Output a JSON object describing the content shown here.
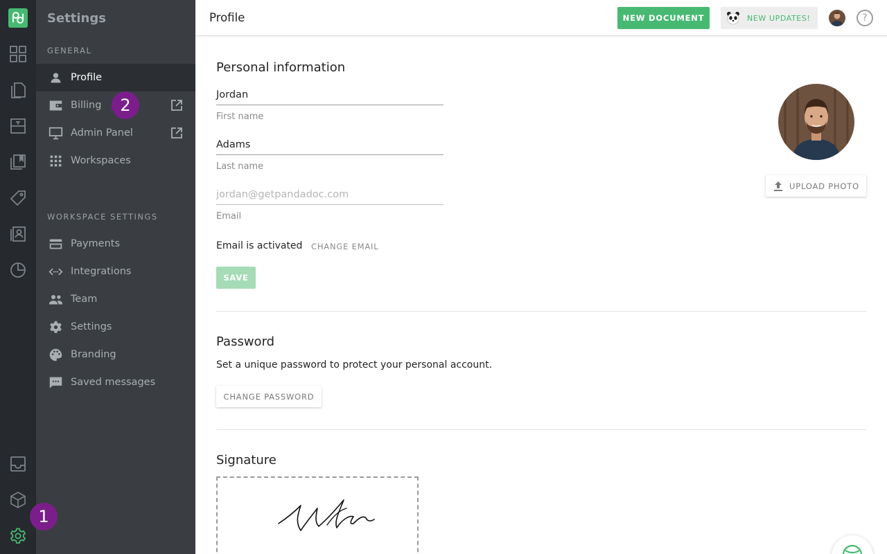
{
  "header": {
    "title": "Profile",
    "new_document_label": "NEW DOCUMENT",
    "new_updates_label": "NEW UPDATES!",
    "help_label": "?"
  },
  "sidebar": {
    "title": "Settings",
    "general_heading": "GENERAL",
    "workspace_heading": "WORKSPACE SETTINGS",
    "general_items": [
      {
        "label": "Profile",
        "icon": "person-icon",
        "active": true
      },
      {
        "label": "Billing",
        "icon": "wallet-icon",
        "external": true
      },
      {
        "label": "Admin Panel",
        "icon": "monitor-icon",
        "external": true
      },
      {
        "label": "Workspaces",
        "icon": "grid-dots-icon"
      }
    ],
    "workspace_items": [
      {
        "label": "Payments",
        "icon": "credit-card-icon"
      },
      {
        "label": "Integrations",
        "icon": "code-arrows-icon"
      },
      {
        "label": "Team",
        "icon": "people-icon"
      },
      {
        "label": "Settings",
        "icon": "gear-icon"
      },
      {
        "label": "Branding",
        "icon": "palette-icon"
      },
      {
        "label": "Saved messages",
        "icon": "chat-icon"
      }
    ]
  },
  "rail": {
    "items": [
      "dashboard-icon",
      "documents-icon",
      "templates-icon",
      "content-library-icon",
      "catalog-tag-icon",
      "contacts-icon",
      "reports-pie-icon",
      "inbox-icon",
      "cube-icon",
      "settings-gear-icon"
    ]
  },
  "badges": {
    "one": "1",
    "two": "2"
  },
  "personal_info": {
    "heading": "Personal information",
    "first_name_value": "Jordan",
    "first_name_label": "First name",
    "last_name_value": "Adams",
    "last_name_label": "Last name",
    "email_placeholder": "jordan@getpandadoc.com",
    "email_label": "Email",
    "email_status": "Email is activated",
    "change_email_label": "CHANGE EMAIL",
    "save_label": "SAVE",
    "upload_photo_label": "UPLOAD PHOTO"
  },
  "password": {
    "heading": "Password",
    "description": "Set a unique password to protect your personal account.",
    "change_password_label": "CHANGE PASSWORD"
  },
  "signature": {
    "heading": "Signature"
  },
  "colors": {
    "brand_green": "#47b972",
    "rail_bg": "#262a2e",
    "sidebar_bg": "#3a3e42",
    "badge_purple": "#7b1e8c"
  }
}
